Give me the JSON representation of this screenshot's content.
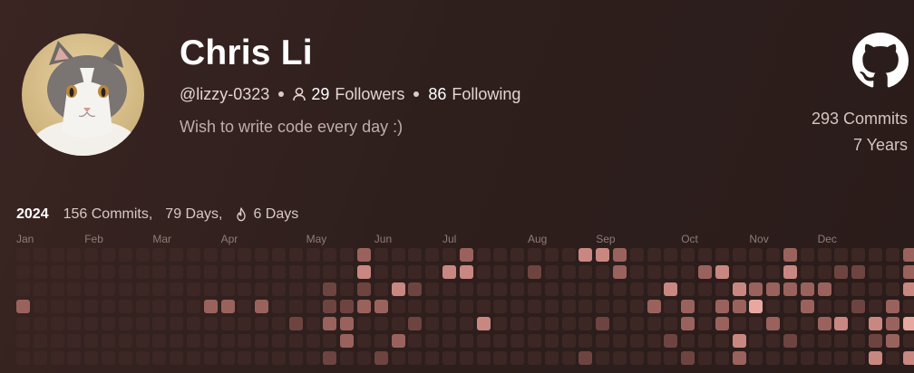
{
  "profile": {
    "name": "Chris Li",
    "handle": "@lizzy-0323",
    "followers_count": "29",
    "followers_label": "Followers",
    "following_count": "86",
    "following_label": "Following",
    "bio": "Wish to write code every day :)"
  },
  "stats": {
    "commits": "293 Commits",
    "years": "7 Years"
  },
  "summary": {
    "year": "2024",
    "commits": "156 Commits,",
    "days": "79 Days,",
    "streak": "6 Days"
  },
  "calendar": {
    "months": [
      {
        "label": "Jan",
        "week": 0
      },
      {
        "label": "Feb",
        "week": 4
      },
      {
        "label": "Mar",
        "week": 8
      },
      {
        "label": "Apr",
        "week": 12
      },
      {
        "label": "May",
        "week": 17
      },
      {
        "label": "Jun",
        "week": 21
      },
      {
        "label": "Jul",
        "week": 25
      },
      {
        "label": "Aug",
        "week": 30
      },
      {
        "label": "Sep",
        "week": 34
      },
      {
        "label": "Oct",
        "week": 39
      },
      {
        "label": "Nov",
        "week": 43
      },
      {
        "label": "Dec",
        "week": 47
      }
    ],
    "weeks": 53,
    "level_colors": [
      "#3c2725",
      "#6e4440",
      "#9a625c",
      "#c98781",
      "#e8a8a2"
    ],
    "active_cells": [
      [
        0,
        3,
        2
      ],
      [
        11,
        3,
        2
      ],
      [
        12,
        3,
        2
      ],
      [
        14,
        3,
        2
      ],
      [
        16,
        4,
        1
      ],
      [
        18,
        2,
        1
      ],
      [
        18,
        3,
        1
      ],
      [
        18,
        4,
        2
      ],
      [
        18,
        6,
        1
      ],
      [
        19,
        3,
        1
      ],
      [
        19,
        4,
        2
      ],
      [
        19,
        5,
        2
      ],
      [
        20,
        0,
        2
      ],
      [
        20,
        1,
        3
      ],
      [
        20,
        2,
        1
      ],
      [
        20,
        3,
        2
      ],
      [
        21,
        3,
        2
      ],
      [
        21,
        6,
        1
      ],
      [
        22,
        2,
        3
      ],
      [
        22,
        5,
        2
      ],
      [
        23,
        2,
        1
      ],
      [
        23,
        4,
        1
      ],
      [
        25,
        1,
        3
      ],
      [
        26,
        0,
        2
      ],
      [
        26,
        1,
        3
      ],
      [
        27,
        4,
        3
      ],
      [
        30,
        1,
        1
      ],
      [
        33,
        0,
        3
      ],
      [
        33,
        6,
        1
      ],
      [
        34,
        0,
        3
      ],
      [
        34,
        4,
        1
      ],
      [
        35,
        0,
        2
      ],
      [
        35,
        1,
        2
      ],
      [
        37,
        3,
        2
      ],
      [
        38,
        2,
        3
      ],
      [
        38,
        5,
        1
      ],
      [
        39,
        3,
        2
      ],
      [
        39,
        4,
        2
      ],
      [
        39,
        6,
        1
      ],
      [
        40,
        1,
        2
      ],
      [
        41,
        1,
        3
      ],
      [
        41,
        3,
        2
      ],
      [
        41,
        4,
        2
      ],
      [
        42,
        2,
        3
      ],
      [
        42,
        3,
        2
      ],
      [
        42,
        5,
        3
      ],
      [
        42,
        6,
        2
      ],
      [
        43,
        2,
        2
      ],
      [
        43,
        3,
        4
      ],
      [
        44,
        2,
        2
      ],
      [
        44,
        4,
        2
      ],
      [
        45,
        0,
        2
      ],
      [
        45,
        1,
        3
      ],
      [
        45,
        2,
        2
      ],
      [
        45,
        5,
        1
      ],
      [
        46,
        2,
        2
      ],
      [
        46,
        3,
        2
      ],
      [
        47,
        2,
        2
      ],
      [
        47,
        4,
        2
      ],
      [
        48,
        1,
        1
      ],
      [
        48,
        4,
        3
      ],
      [
        49,
        1,
        1
      ],
      [
        49,
        3,
        1
      ],
      [
        50,
        4,
        3
      ],
      [
        50,
        5,
        1
      ],
      [
        50,
        6,
        3
      ],
      [
        51,
        3,
        2
      ],
      [
        51,
        4,
        2
      ],
      [
        51,
        5,
        2
      ],
      [
        52,
        0,
        2
      ],
      [
        52,
        1,
        2
      ],
      [
        52,
        2,
        3
      ],
      [
        52,
        4,
        4
      ],
      [
        52,
        6,
        3
      ]
    ]
  }
}
